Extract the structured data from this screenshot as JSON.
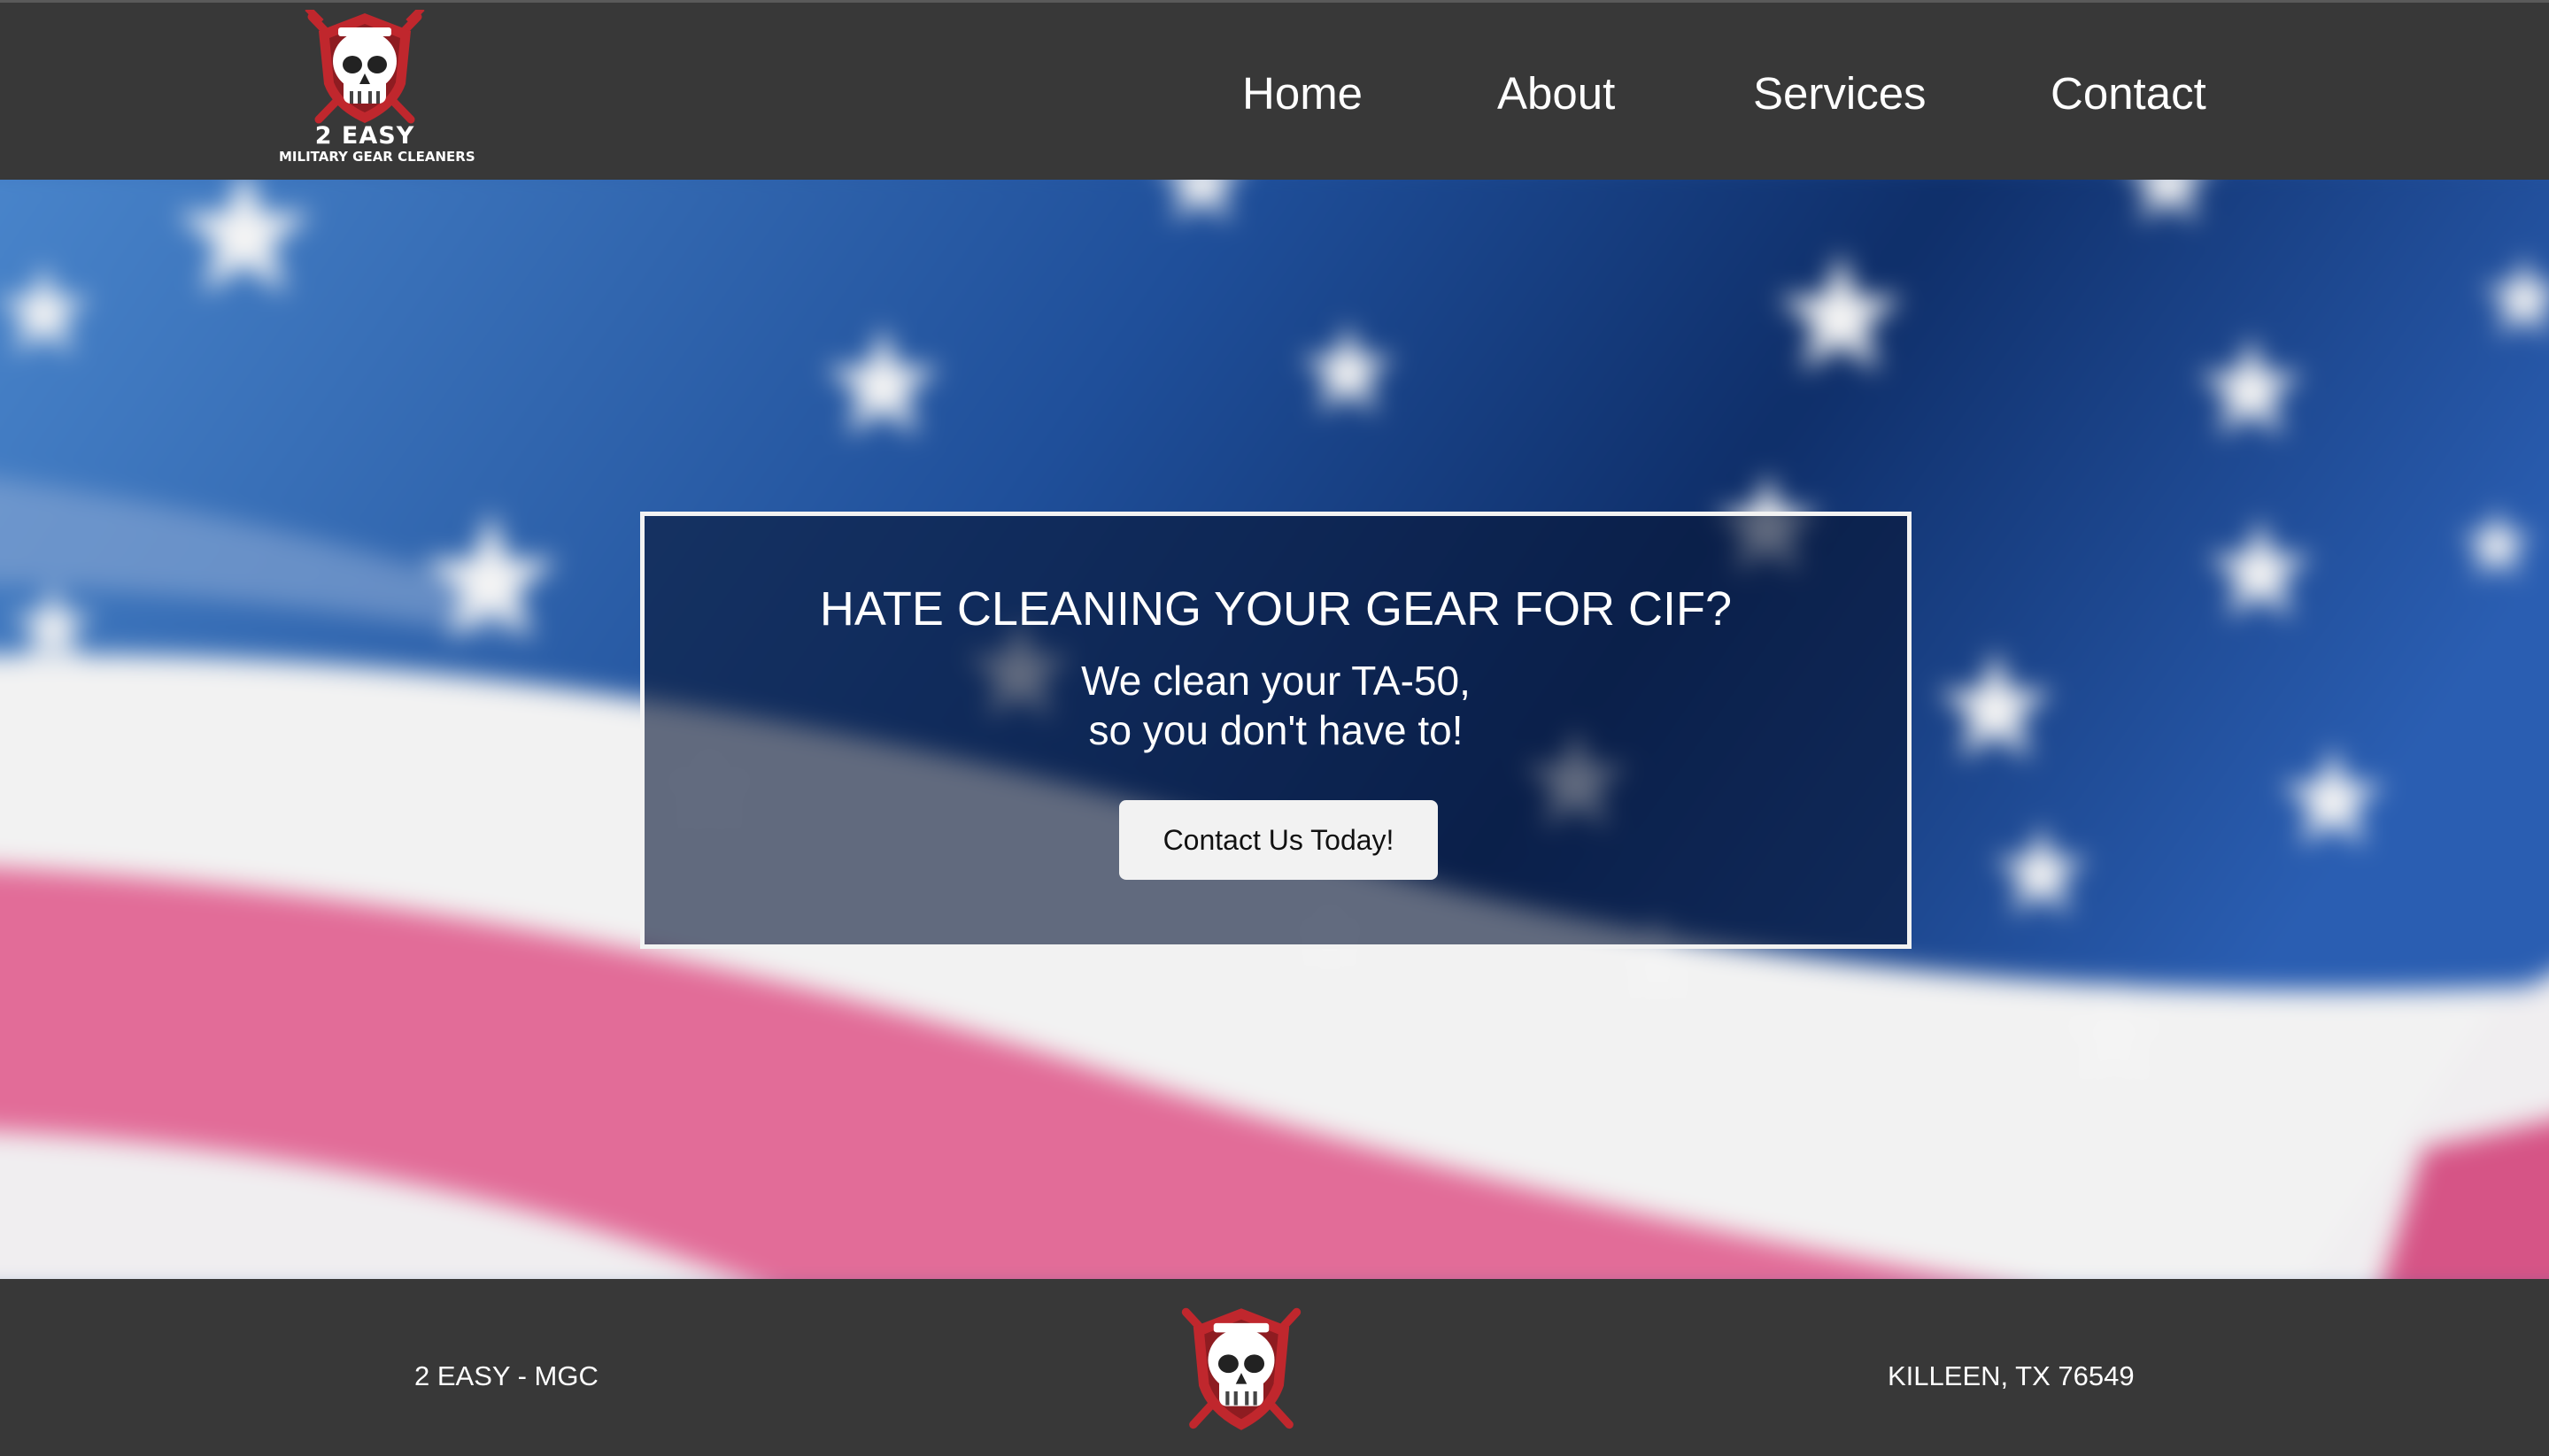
{
  "brand": {
    "logo_title": "2 EASY",
    "logo_subtitle": "MILITARY GEAR CLEANERS",
    "accent_color": "#c0272d"
  },
  "nav": {
    "items": [
      {
        "label": "Home"
      },
      {
        "label": "About"
      },
      {
        "label": "Services"
      },
      {
        "label": "Contact"
      }
    ]
  },
  "hero": {
    "title": "HATE CLEANING YOUR GEAR FOR CIF?",
    "subtitle_line1": "We clean your TA-50,",
    "subtitle_line2": "so you don't have to!",
    "cta_label": "Contact Us Today!",
    "background": "american-flag"
  },
  "footer": {
    "left_text": "2 EASY - MGC",
    "right_text": "KILLEEN, TX 76549"
  }
}
